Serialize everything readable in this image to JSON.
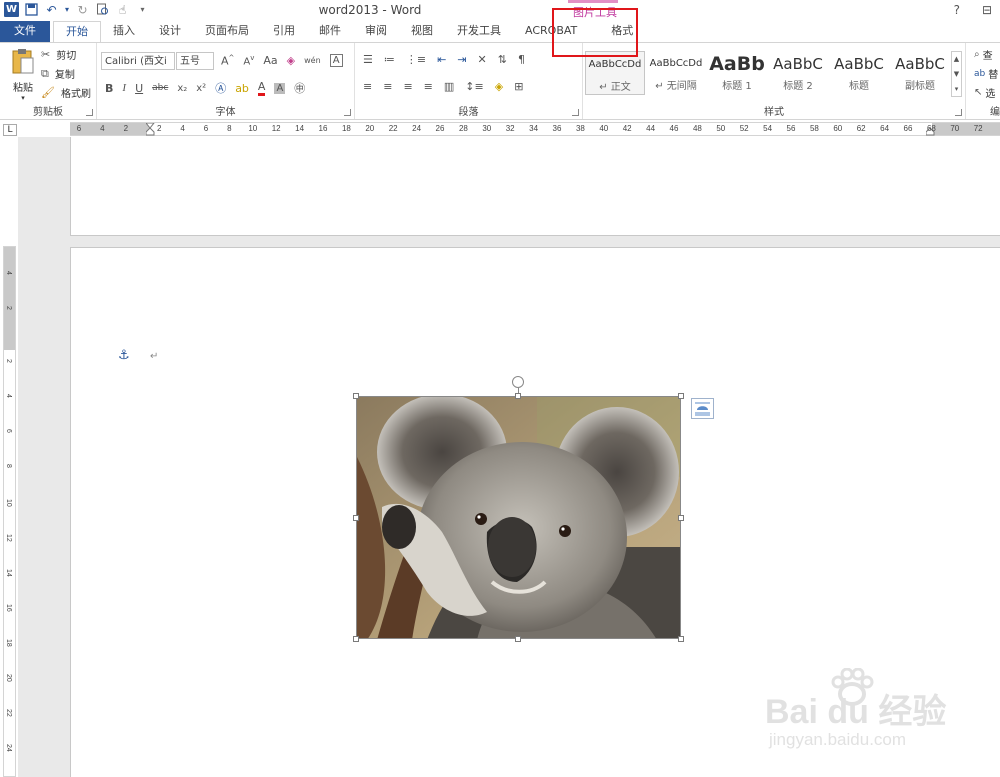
{
  "window": {
    "title": "word2013 - Word",
    "help": "?",
    "restore": "⊟"
  },
  "context_tab_group": "图片工具",
  "tabs": [
    "文件",
    "开始",
    "插入",
    "设计",
    "页面布局",
    "引用",
    "邮件",
    "审阅",
    "视图",
    "开发工具",
    "ACROBAT",
    "格式"
  ],
  "ribbon": {
    "clipboard": {
      "label": "剪贴板",
      "paste": "粘贴",
      "cut": "剪切",
      "copy": "复制",
      "format_painter": "格式刷"
    },
    "font": {
      "label": "字体",
      "font_name": "Calibri (西文i",
      "font_size": "五号",
      "bold": "B",
      "italic": "I",
      "underline": "U",
      "strike": "abc",
      "subscript": "x₂",
      "superscript": "x²",
      "font_color": "A",
      "aa": "Aa",
      "wen": "wén",
      "boxed": "A"
    },
    "paragraph": {
      "label": "段落"
    },
    "styles": {
      "label": "样式",
      "items": [
        {
          "sample": "AaBbCcDd",
          "name": "↵ 正文"
        },
        {
          "sample": "AaBbCcDd",
          "name": "↵ 无间隔"
        },
        {
          "sample": "AaBb",
          "name": "标题 1"
        },
        {
          "sample": "AaBbC",
          "name": "标题 2"
        },
        {
          "sample": "AaBbC",
          "name": "标题"
        },
        {
          "sample": "AaBbC",
          "name": "副标题"
        }
      ]
    },
    "editing": {
      "label": "编",
      "find": "查",
      "replace": "替",
      "select": "选"
    }
  },
  "ruler": {
    "tab_selector": "L",
    "h_ticks": [
      "6",
      "4",
      "2",
      "2",
      "4",
      "6",
      "8",
      "10",
      "12",
      "14",
      "16",
      "18",
      "20",
      "22",
      "24",
      "26",
      "28",
      "30",
      "32",
      "34",
      "36",
      "38",
      "40",
      "42",
      "44",
      "46",
      "48",
      "50",
      "52",
      "54",
      "56",
      "58",
      "60",
      "62",
      "64",
      "66",
      "68",
      "70",
      "72"
    ],
    "v_ticks": [
      "4",
      "2",
      "2",
      "4",
      "6",
      "8",
      "10",
      "12",
      "14",
      "16",
      "18",
      "20",
      "22",
      "24"
    ]
  },
  "document": {
    "anchor": "⚓",
    "paragraph_mark": "↵"
  },
  "watermark": {
    "main": "Bai du 经验",
    "sub": "jingyan.baidu.com"
  }
}
